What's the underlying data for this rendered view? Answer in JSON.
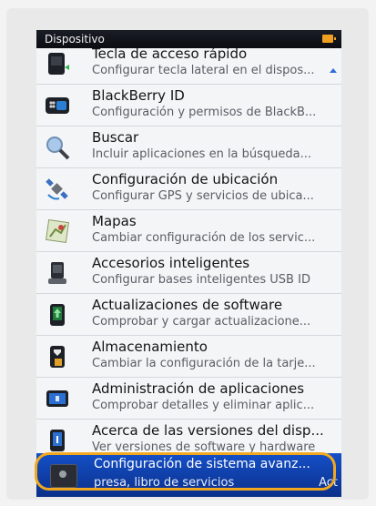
{
  "statusbar": {
    "title": "Dispositivo"
  },
  "items": [
    {
      "title": "Tecla de acceso rápido",
      "subtitle": "Configurar tecla lateral en el dispos..."
    },
    {
      "title": "BlackBerry ID",
      "subtitle": "Configuración y permisos de BlackB..."
    },
    {
      "title": "Buscar",
      "subtitle": "Incluir aplicaciones en la búsqueda..."
    },
    {
      "title": "Configuración de ubicación",
      "subtitle": "Configurar GPS y servicios de ubica..."
    },
    {
      "title": "Mapas",
      "subtitle": "Cambiar configuración de los servic..."
    },
    {
      "title": "Accesorios inteligentes",
      "subtitle": "Configurar bases inteligentes USB ID"
    },
    {
      "title": "Actualizaciones de software",
      "subtitle": "Comprobar y cargar actualizacione..."
    },
    {
      "title": "Almacenamiento",
      "subtitle": "Cambiar la configuración de la tarje..."
    },
    {
      "title": "Administración de aplicaciones",
      "subtitle": "Comprobar detalles y eliminar aplic..."
    },
    {
      "title": "Acerca de las versiones del disp...",
      "subtitle": "Ver versiones de software y hardware"
    }
  ],
  "selected": {
    "title": "Configuración de sistema avanz...",
    "subtitle": "presa, libro de servicios",
    "trailing": "Act"
  },
  "colors": {
    "accent": "#1450c8",
    "highlight": "#f2a81e"
  }
}
